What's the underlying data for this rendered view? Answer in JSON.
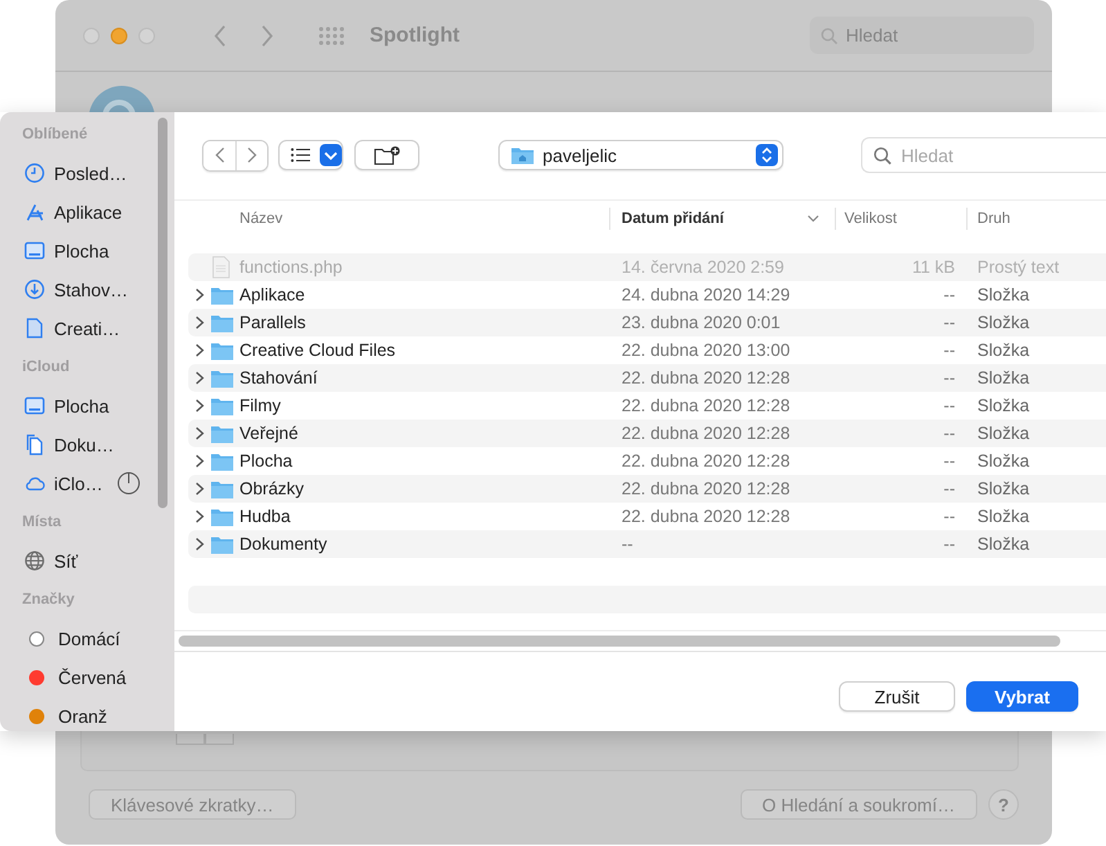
{
  "background_window": {
    "title": "Spotlight",
    "search": {
      "placeholder": "Hledat"
    },
    "buttons": [
      "Klávesové zkratky…",
      "O Hledání a soukromí…"
    ],
    "help": "?"
  },
  "dialog": {
    "location": "paveljelic",
    "search": {
      "placeholder": "Hledat"
    },
    "sidebar": [
      {
        "header": "Oblíbené",
        "items": [
          {
            "kind": "clock",
            "label": "Posled…"
          },
          {
            "kind": "apps",
            "label": "Aplikace"
          },
          {
            "kind": "desktop",
            "label": "Plocha"
          },
          {
            "kind": "download",
            "label": "Stahov…"
          },
          {
            "kind": "document",
            "label": "Creati…"
          }
        ]
      },
      {
        "header": "iCloud",
        "items": [
          {
            "kind": "desktop",
            "label": "Plocha"
          },
          {
            "kind": "documents",
            "label": "Doku…"
          },
          {
            "kind": "cloud",
            "label": "iClo…",
            "syncing": true
          }
        ]
      },
      {
        "header": "Místa",
        "items": [
          {
            "kind": "network",
            "label": "Síť"
          }
        ]
      },
      {
        "header": "Značky",
        "items": [
          {
            "kind": "tag",
            "label": "Domácí",
            "color": "#ffffff"
          },
          {
            "kind": "tag",
            "label": "Červená",
            "color": "#ff3b30"
          },
          {
            "kind": "tag",
            "label": "Oranž",
            "color": "#e0820a"
          }
        ]
      }
    ],
    "columns": [
      {
        "label": "Název",
        "sorted": false
      },
      {
        "label": "Datum přidání",
        "sorted": true
      },
      {
        "label": "Velikost",
        "sorted": false
      },
      {
        "label": "Druh",
        "sorted": false
      }
    ],
    "rows": [
      {
        "kind": "file",
        "name": "functions.php",
        "date": "14. června 2020 2:59",
        "size": "11 kB",
        "type": "Prostý text",
        "disabled": true
      },
      {
        "kind": "folder",
        "name": "Aplikace",
        "date": "24. dubna 2020 14:29",
        "size": "--",
        "type": "Složka",
        "disabled": false
      },
      {
        "kind": "folder",
        "name": "Parallels",
        "date": "23. dubna 2020 0:01",
        "size": "--",
        "type": "Složka",
        "disabled": false
      },
      {
        "kind": "folder",
        "name": "Creative Cloud Files",
        "date": "22. dubna 2020 13:00",
        "size": "--",
        "type": "Složka",
        "disabled": false
      },
      {
        "kind": "folder",
        "name": "Stahování",
        "date": "22. dubna 2020 12:28",
        "size": "--",
        "type": "Složka",
        "disabled": false
      },
      {
        "kind": "folder",
        "name": "Filmy",
        "date": "22. dubna 2020 12:28",
        "size": "--",
        "type": "Složka",
        "disabled": false
      },
      {
        "kind": "folder",
        "name": "Veřejné",
        "date": "22. dubna 2020 12:28",
        "size": "--",
        "type": "Složka",
        "disabled": false
      },
      {
        "kind": "folder",
        "name": "Plocha",
        "date": "22. dubna 2020 12:28",
        "size": "--",
        "type": "Složka",
        "disabled": false
      },
      {
        "kind": "folder",
        "name": "Obrázky",
        "date": "22. dubna 2020 12:28",
        "size": "--",
        "type": "Složka",
        "disabled": false
      },
      {
        "kind": "folder",
        "name": "Hudba",
        "date": "22. dubna 2020 12:28",
        "size": "--",
        "type": "Složka",
        "disabled": false
      },
      {
        "kind": "folder",
        "name": "Dokumenty",
        "date": "--",
        "size": "--",
        "type": "Složka",
        "disabled": false
      }
    ],
    "buttons": [
      {
        "label": "Zrušit",
        "default": false
      },
      {
        "label": "Vybrat",
        "default": true
      }
    ]
  }
}
